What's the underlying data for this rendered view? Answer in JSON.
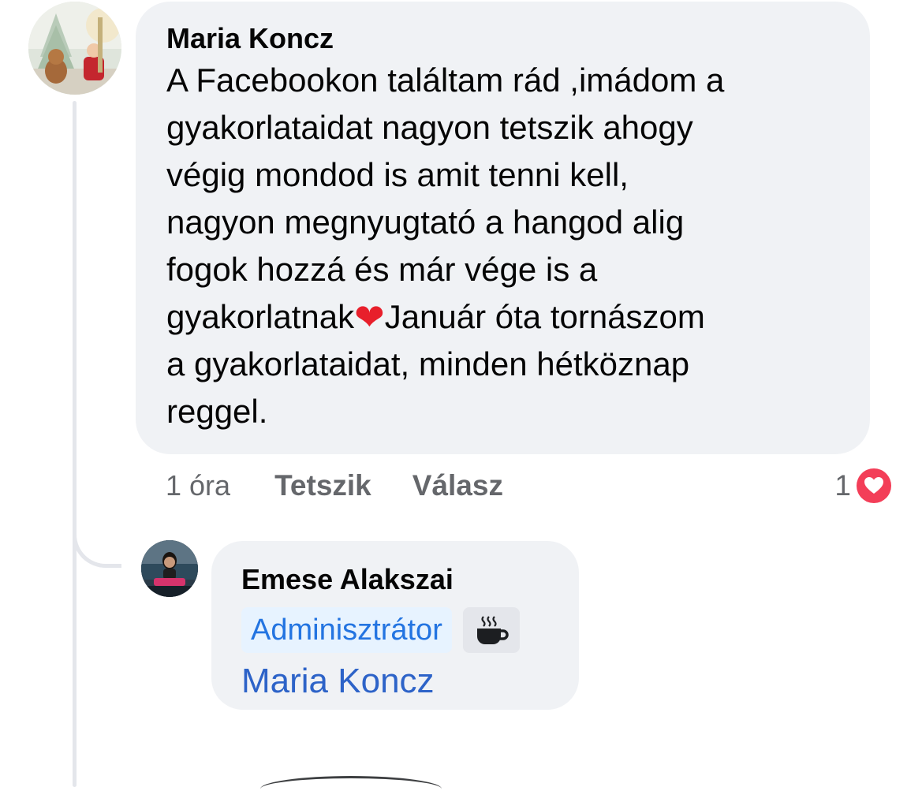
{
  "comment": {
    "author": "Maria Koncz",
    "text_lines": [
      "A Facebookon találtam rád ,imádom a",
      "gyakorlataidat nagyon tetszik ahogy",
      "végig mondod is amit tenni kell,",
      "nagyon megnyugtató a hangod alig",
      "fogok hozzá és már vége is a"
    ],
    "line6_before": "gyakorlatnak",
    "line6_emoji": "❤",
    "line6_after": "Január óta tornászom",
    "text_lines_end": [
      "a gyakorlataidat, minden hétköznap",
      "reggel."
    ],
    "time": "1 óra",
    "like_label": "Tetszik",
    "reply_label": "Válasz",
    "reaction_count": "1",
    "reaction_icon": "heart-reaction-icon",
    "reaction_color": "#f33e58"
  },
  "reply": {
    "author": "Emese Alakszai",
    "role_badge": "Adminisztrátor",
    "extra_badge_icon": "coffee-cup-icon",
    "mention": "Maria Koncz"
  },
  "colors": {
    "bubble_bg": "#f0f2f5",
    "secondary_text": "#65676b",
    "link_blue": "#2d63c8",
    "badge_bg": "#e7f3ff"
  }
}
